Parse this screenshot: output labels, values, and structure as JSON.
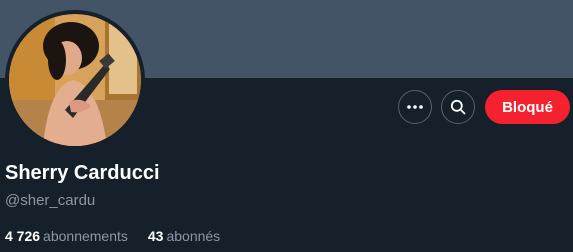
{
  "profile": {
    "display_name": "Sherry Carducci",
    "handle": "@sher_cardu"
  },
  "actions": {
    "more_icon": "more-horizontal-icon",
    "search_icon": "search-icon",
    "blocked_label": "Bloqué"
  },
  "stats": {
    "following_count": "4 726",
    "following_label": "abonnements",
    "followers_count": "43",
    "followers_label": "abonnés"
  },
  "colors": {
    "background": "#15202b",
    "banner": "#425466",
    "blocked_button": "#f4212e",
    "secondary_text": "#8b98a5"
  }
}
